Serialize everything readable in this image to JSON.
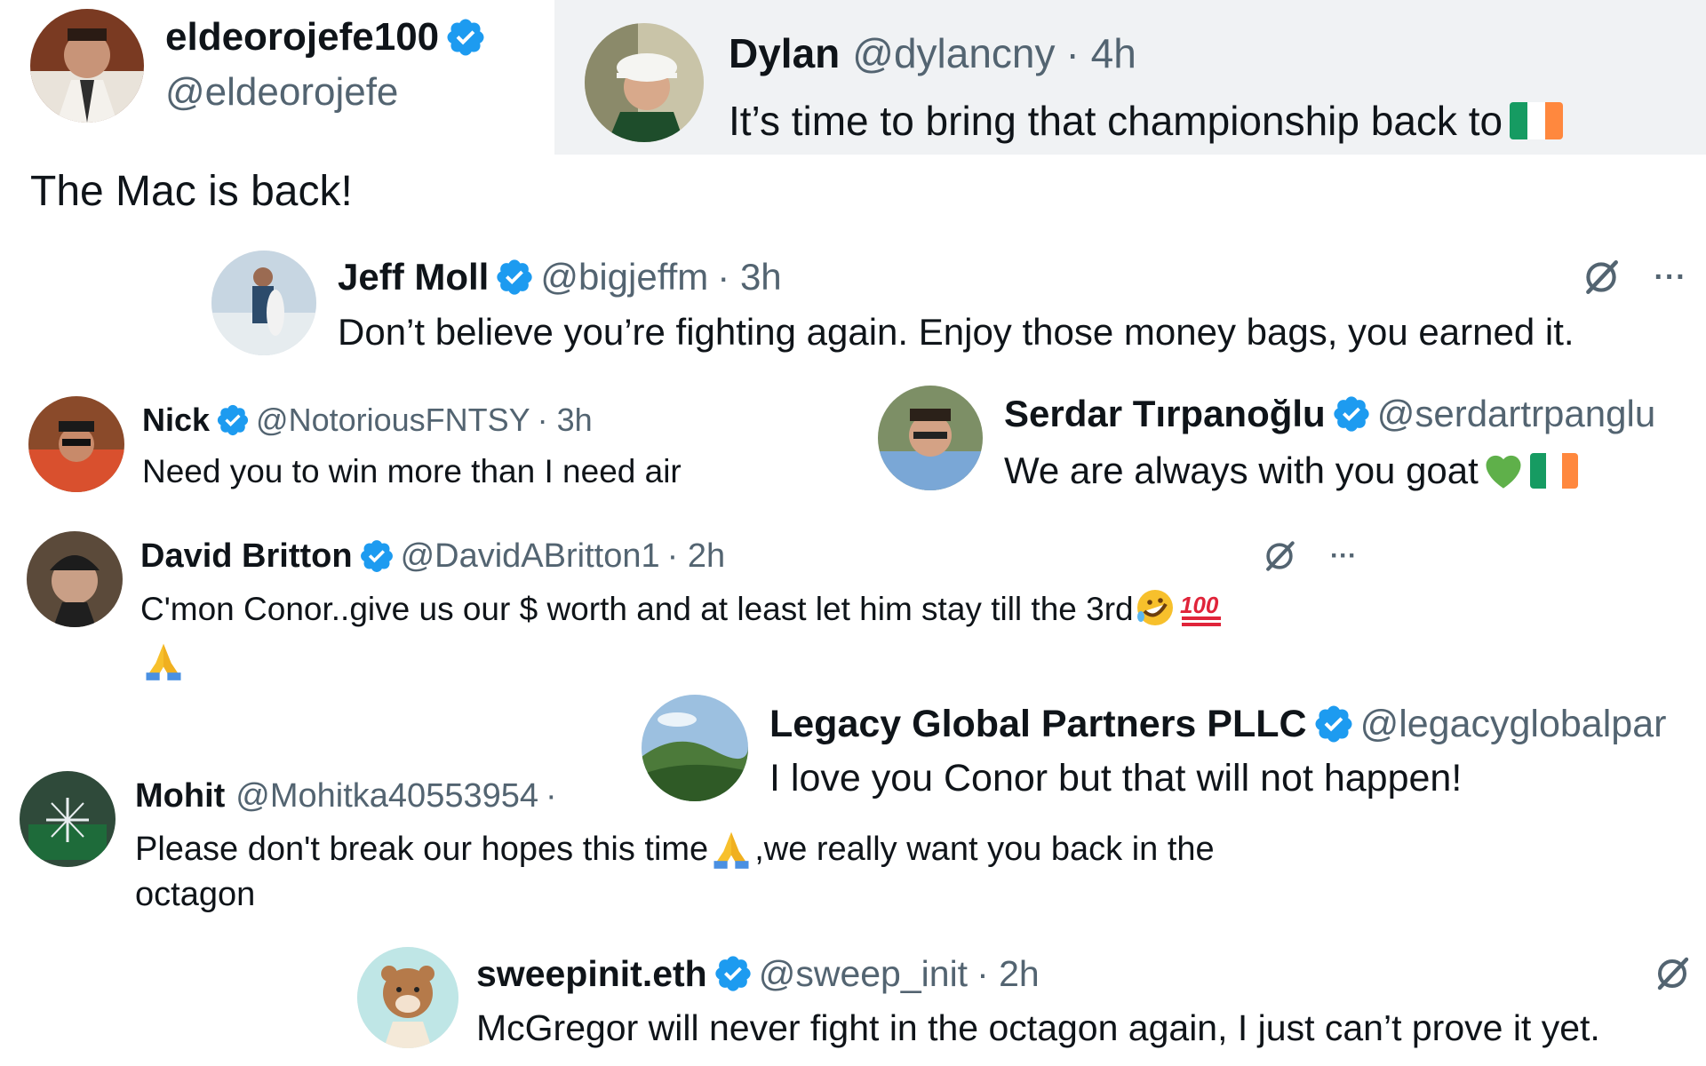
{
  "colors": {
    "verified": "#1d9bf0",
    "handle": "#536471",
    "text": "#0f1419",
    "highlight_bg": "#f0f2f4",
    "flag_green": "#169b62",
    "flag_orange": "#ff883e"
  },
  "main_post": {
    "display_name": "eldeorojefe100",
    "handle": "@eldeorojefe",
    "text": "The Mac is back!"
  },
  "quoted_post": {
    "display_name": "Dylan",
    "handle": "@dylancny",
    "time": "· 4h",
    "text": "It’s time to bring that championship back to"
  },
  "replies": [
    {
      "display_name": "Jeff Moll",
      "handle": "@bigjeffm",
      "time": "· 3h",
      "text": "Don’t believe you’re fighting again. Enjoy those money bags, you earned it."
    },
    {
      "display_name": "Nick",
      "handle": "@NotoriousFNTSY",
      "time": "· 3h",
      "text": "Need you to win more than I need air"
    },
    {
      "display_name": "Serdar Tırpanoğlu",
      "handle": "@serdartrpanglu",
      "text": "We are always with you goat"
    },
    {
      "display_name": "David Britton",
      "handle": "@DavidABritton1",
      "time": "· 2h",
      "text": "C'mon Conor..give us our $ worth and at least let him stay till the 3rd"
    },
    {
      "display_name": "Legacy Global Partners PLLC",
      "handle": "@legacyglobalpar",
      "text": "I love you Conor but that will not happen!"
    },
    {
      "display_name": "Mohit",
      "handle": "@Mohitka40553954",
      "time": "·",
      "text_line1": "Please don't break our hopes this time",
      "text_line1_after": ",we really want you back in the",
      "text_line2": "octagon"
    },
    {
      "display_name": "sweepinit.eth",
      "handle": "@sweep_init",
      "time": "· 2h",
      "text": "McGregor will never fight in the octagon again, I just can’t prove it yet."
    }
  ],
  "icons": {
    "verified": "verified-badge-icon",
    "grok": "grok-icon",
    "more": "more-icon"
  },
  "more_label": "···"
}
